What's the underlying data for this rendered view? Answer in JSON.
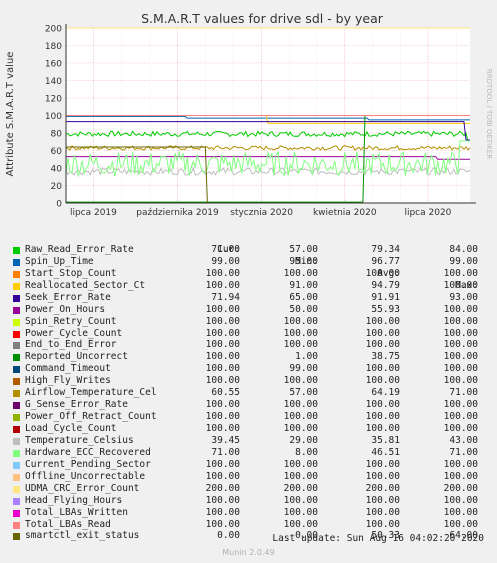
{
  "chart_data": {
    "type": "line",
    "title": "S.M.A.R.T values for drive sdl - by year",
    "ylabel": "Attribute S.M.A.R.T value",
    "side_label": "RRDTOOL / TOBI OETIKER",
    "ylim": [
      0,
      200
    ],
    "y_ticks": [
      "0",
      "20",
      "40",
      "60",
      "80",
      "100",
      "120",
      "140",
      "160",
      "180",
      "200"
    ],
    "x_ticks": [
      "lipca 2019",
      "października 2019",
      "stycznia 2020",
      "kwietnia 2020",
      "lipca 2020"
    ],
    "x_range": [
      "2019-06-01",
      "2020-08-16"
    ],
    "grid": true,
    "legend_headers": {
      "cur": "Cur:",
      "min": "Min:",
      "avg": "Avg:",
      "max": "Max:"
    },
    "series": [
      {
        "name": "Raw_Read_Error_Rate",
        "color": "#00cc00",
        "cur": "71.00",
        "min": "57.00",
        "avg": "79.34",
        "max": "84.00"
      },
      {
        "name": "Spin_Up_Time",
        "color": "#0066b3",
        "cur": "99.00",
        "min": "95.00",
        "avg": "96.77",
        "max": "99.00"
      },
      {
        "name": "Start_Stop_Count",
        "color": "#ff8000",
        "cur": "100.00",
        "min": "100.00",
        "avg": "100.00",
        "max": "100.00"
      },
      {
        "name": "Reallocated_Sector_Ct",
        "color": "#ffcc00",
        "cur": "100.00",
        "min": "91.00",
        "avg": "94.79",
        "max": "100.00"
      },
      {
        "name": "Seek_Error_Rate",
        "color": "#330099",
        "cur": "71.94",
        "min": "65.00",
        "avg": "91.91",
        "max": "93.00"
      },
      {
        "name": "Power_On_Hours",
        "color": "#990099",
        "cur": "100.00",
        "min": "50.00",
        "avg": "55.93",
        "max": "100.00"
      },
      {
        "name": "Spin_Retry_Count",
        "color": "#ccff00",
        "cur": "100.00",
        "min": "100.00",
        "avg": "100.00",
        "max": "100.00"
      },
      {
        "name": "Power_Cycle_Count",
        "color": "#ff0000",
        "cur": "100.00",
        "min": "100.00",
        "avg": "100.00",
        "max": "100.00"
      },
      {
        "name": "End_to_End_Error",
        "color": "#808080",
        "cur": "100.00",
        "min": "100.00",
        "avg": "100.00",
        "max": "100.00"
      },
      {
        "name": "Reported_Uncorrect",
        "color": "#008f00",
        "cur": "100.00",
        "min": "1.00",
        "avg": "38.75",
        "max": "100.00"
      },
      {
        "name": "Command_Timeout",
        "color": "#00487d",
        "cur": "100.00",
        "min": "99.00",
        "avg": "100.00",
        "max": "100.00"
      },
      {
        "name": "High_Fly_Writes",
        "color": "#b35a00",
        "cur": "100.00",
        "min": "100.00",
        "avg": "100.00",
        "max": "100.00"
      },
      {
        "name": "Airflow_Temperature_Cel",
        "color": "#b38f00",
        "cur": "60.55",
        "min": "57.00",
        "avg": "64.19",
        "max": "71.00"
      },
      {
        "name": "G_Sense_Error_Rate",
        "color": "#6b006b",
        "cur": "100.00",
        "min": "100.00",
        "avg": "100.00",
        "max": "100.00"
      },
      {
        "name": "Power_Off_Retract_Count",
        "color": "#8fb300",
        "cur": "100.00",
        "min": "100.00",
        "avg": "100.00",
        "max": "100.00"
      },
      {
        "name": "Load_Cycle_Count",
        "color": "#b30000",
        "cur": "100.00",
        "min": "100.00",
        "avg": "100.00",
        "max": "100.00"
      },
      {
        "name": "Temperature_Celsius",
        "color": "#bebebe",
        "cur": "39.45",
        "min": "29.00",
        "avg": "35.81",
        "max": "43.00"
      },
      {
        "name": "Hardware_ECC_Recovered",
        "color": "#80ff80",
        "cur": "71.00",
        "min": "8.00",
        "avg": "46.51",
        "max": "71.00"
      },
      {
        "name": "Current_Pending_Sector",
        "color": "#80c9ff",
        "cur": "100.00",
        "min": "100.00",
        "avg": "100.00",
        "max": "100.00"
      },
      {
        "name": "Offline_Uncorrectable",
        "color": "#ffc080",
        "cur": "100.00",
        "min": "100.00",
        "avg": "100.00",
        "max": "100.00"
      },
      {
        "name": "UDMA_CRC_Error_Count",
        "color": "#ffe680",
        "cur": "200.00",
        "min": "200.00",
        "avg": "200.00",
        "max": "200.00"
      },
      {
        "name": "Head_Flying_Hours",
        "color": "#aa80ff",
        "cur": "100.00",
        "min": "100.00",
        "avg": "100.00",
        "max": "100.00"
      },
      {
        "name": "Total_LBAs_Written",
        "color": "#ee00cc",
        "cur": "100.00",
        "min": "100.00",
        "avg": "100.00",
        "max": "100.00"
      },
      {
        "name": "Total_LBAs_Read",
        "color": "#ff8080",
        "cur": "100.00",
        "min": "100.00",
        "avg": "100.00",
        "max": "100.00"
      },
      {
        "name": "smartctl_exit_status",
        "color": "#666600",
        "cur": "0.00",
        "min": "0.00",
        "avg": "50.33",
        "max": "64.00"
      }
    ]
  },
  "footer": {
    "last_update": "Last update: Sun Aug 16 04:02:20 2020",
    "version": "Munin 2.0.49"
  }
}
